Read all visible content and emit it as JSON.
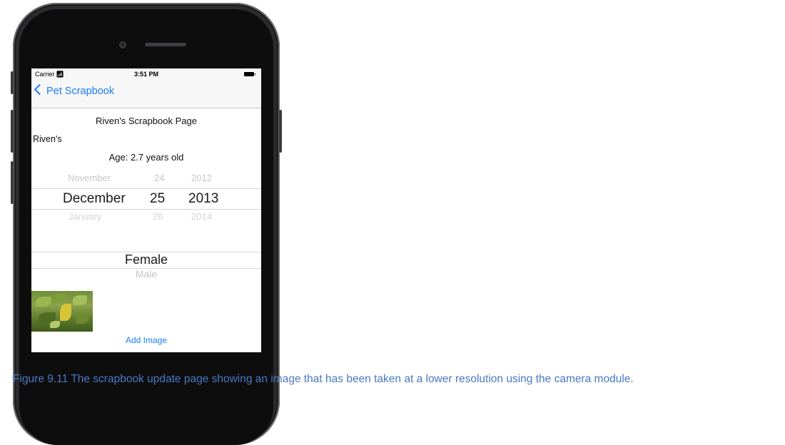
{
  "status_bar": {
    "carrier": "Carrier",
    "time": "3:51 PM"
  },
  "nav": {
    "back_label": "Pet Scrapbook"
  },
  "page": {
    "title": "Riven's Scrapbook Page",
    "name_field": "Riven's",
    "age": "Age: 2.7 years old"
  },
  "date_picker": {
    "months": [
      "November",
      "December",
      "January"
    ],
    "days": [
      "24",
      "25",
      "26"
    ],
    "years": [
      "2012",
      "2013",
      "2014"
    ],
    "selected_month": "December",
    "selected_day": "25",
    "selected_year": "2013"
  },
  "gender_picker": {
    "options": [
      "Female",
      "Male"
    ],
    "selected": "Female"
  },
  "image": {
    "add_label": "Add Image"
  },
  "caption": "Figure 9.11 The scrapbook update page showing an image that has been taken at a lower resolution using the camera module.",
  "colors": {
    "ios_blue": "#1b7ef5",
    "caption_blue": "#4a78c2"
  }
}
